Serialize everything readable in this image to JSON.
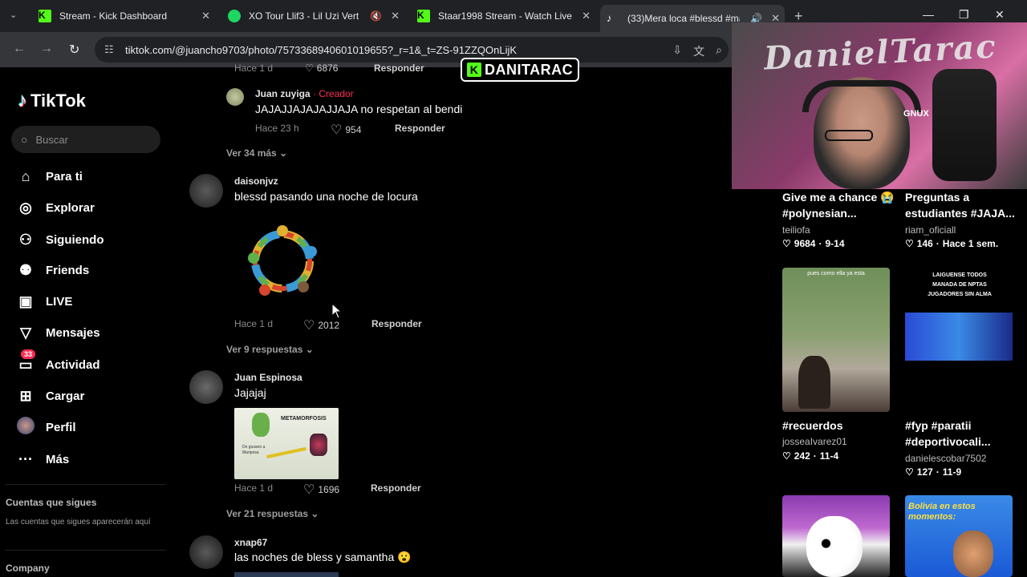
{
  "browser": {
    "tabs": [
      {
        "title": "Stream - Kick Dashboard",
        "icon": "kick-icon"
      },
      {
        "title": "XO Tour Llif3 - Lil Uzi Vert",
        "icon": "spotify-icon"
      },
      {
        "title": "Staar1998 Stream - Watch Live",
        "icon": "kick-icon"
      },
      {
        "title": "(33)Mera loca #blessd #ma",
        "icon": "tiktok-icon"
      }
    ],
    "url": "tiktok.com/@juancho9703/photo/7573368940601019655?_r=1&_t=ZS-91ZZQOnLijK"
  },
  "overlay": {
    "kick_name": "DANITARAC",
    "kick_letter": "K"
  },
  "sidebar": {
    "brand": "TikTok",
    "search_placeholder": "Buscar",
    "items": [
      {
        "label": "Para ti",
        "icon": "home-icon"
      },
      {
        "label": "Explorar",
        "icon": "compass-icon"
      },
      {
        "label": "Siguiendo",
        "icon": "following-icon"
      },
      {
        "label": "Friends",
        "icon": "friends-icon"
      },
      {
        "label": "LIVE",
        "icon": "live-icon"
      },
      {
        "label": "Mensajes",
        "icon": "messages-icon"
      },
      {
        "label": "Actividad",
        "icon": "activity-icon",
        "badge": "33"
      },
      {
        "label": "Cargar",
        "icon": "upload-icon"
      },
      {
        "label": "Perfil",
        "icon": "profile-icon"
      },
      {
        "label": "Más",
        "icon": "more-icon"
      }
    ],
    "following_title": "Cuentas que sigues",
    "following_subtitle": "Las cuentas que sigues aparecerán aquí",
    "company": "Company"
  },
  "comments": {
    "top_partial": {
      "likes": "6876",
      "reply": "Responder"
    },
    "reply1": {
      "user": "Juan zuyiga",
      "tag": " · Creador",
      "text": "JAJAJJAJAJAJJAJA no respetan al bendi",
      "time": "Hace 23 h",
      "likes": "954",
      "reply": "Responder"
    },
    "more1": "Ver 34 más",
    "c1": {
      "user": "daisonjvz",
      "text": "blessd pasando una noche de locura",
      "time": "Hace 1 d",
      "likes": "2012",
      "reply": "Responder",
      "more": "Ver 9 respuestas"
    },
    "c2": {
      "user": "Juan Espinosa",
      "text": "Jajajaj",
      "image_title": "METAMORFOSIS",
      "image_caption_left": "De gusano a Mariposa",
      "time": "Hace 1 d",
      "likes": "1696",
      "reply": "Responder",
      "more": "Ver 21 respuestas"
    },
    "c3": {
      "user": "xnap67",
      "text": "las noches de bless y samantha 😮"
    }
  },
  "related": [
    {
      "title": "Give me a chance 😭 #polynesian...",
      "author": "teiliofa",
      "likes": "9684",
      "date": "9-14"
    },
    {
      "title": "Preguntas a estudiantes #JAJA...",
      "author": "riam_oficiall",
      "likes": "146",
      "date": "Hace 1 sem."
    },
    {
      "title": "#recuerdos",
      "author": "josseaIvarez01",
      "likes": "242",
      "date": "11-4"
    },
    {
      "title": "#fyp #paratii #deportivocali...",
      "author": "danielescobar7502",
      "likes": "127",
      "date": "11-9"
    }
  ],
  "related_thumbs": {
    "thumb3_caption": "pues como ella ya esta",
    "thumb4_caption": "LAIGUENSE TODOS MANADA DE NPTAS JUGADORES SIN ALMA",
    "thumb6_caption": "Bolivia en estos momentos:"
  },
  "webcam": {
    "graffiti": "DanielTarac",
    "brand": "GNUX"
  },
  "colors": {
    "accent": "#fe2c55",
    "kick": "#53fc18",
    "spotify": "#1ed760"
  }
}
